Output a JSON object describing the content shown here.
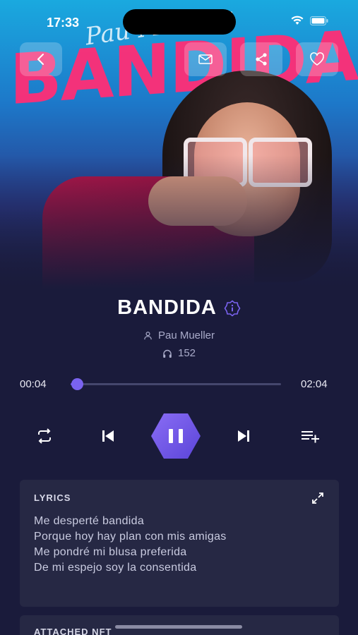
{
  "status_bar": {
    "time": "17:33"
  },
  "art": {
    "overlay_title": "BANDIDA",
    "overlay_script": "Pau Mueller"
  },
  "song": {
    "title": "BANDIDA",
    "artist": "Pau Mueller",
    "plays": "152"
  },
  "player": {
    "elapsed": "00:04",
    "duration": "02:04",
    "progress_fraction": 0.03,
    "state": "playing"
  },
  "lyrics": {
    "heading": "LYRICS",
    "lines": [
      "Me desperté bandida",
      "Porque hoy hay plan con mis amigas",
      "Me pondré mi blusa preferida",
      "De mi espejo soy la consentida"
    ]
  },
  "attached_nft": {
    "heading": "ATTACHED NFT"
  },
  "icons": {
    "back": "chevron-left-icon",
    "message": "envelope-icon",
    "share": "share-icon",
    "favorite": "heart-icon",
    "verified": "info-badge-icon",
    "repeat": "repeat-icon",
    "prev": "skip-previous-icon",
    "pause": "pause-icon",
    "next": "skip-next-icon",
    "queue": "add-to-queue-icon",
    "expand": "expand-icon"
  },
  "colors": {
    "accent": "#7a63f0",
    "background": "#1a1b3b",
    "card": "#262844",
    "art_pink": "#ff2e76"
  }
}
